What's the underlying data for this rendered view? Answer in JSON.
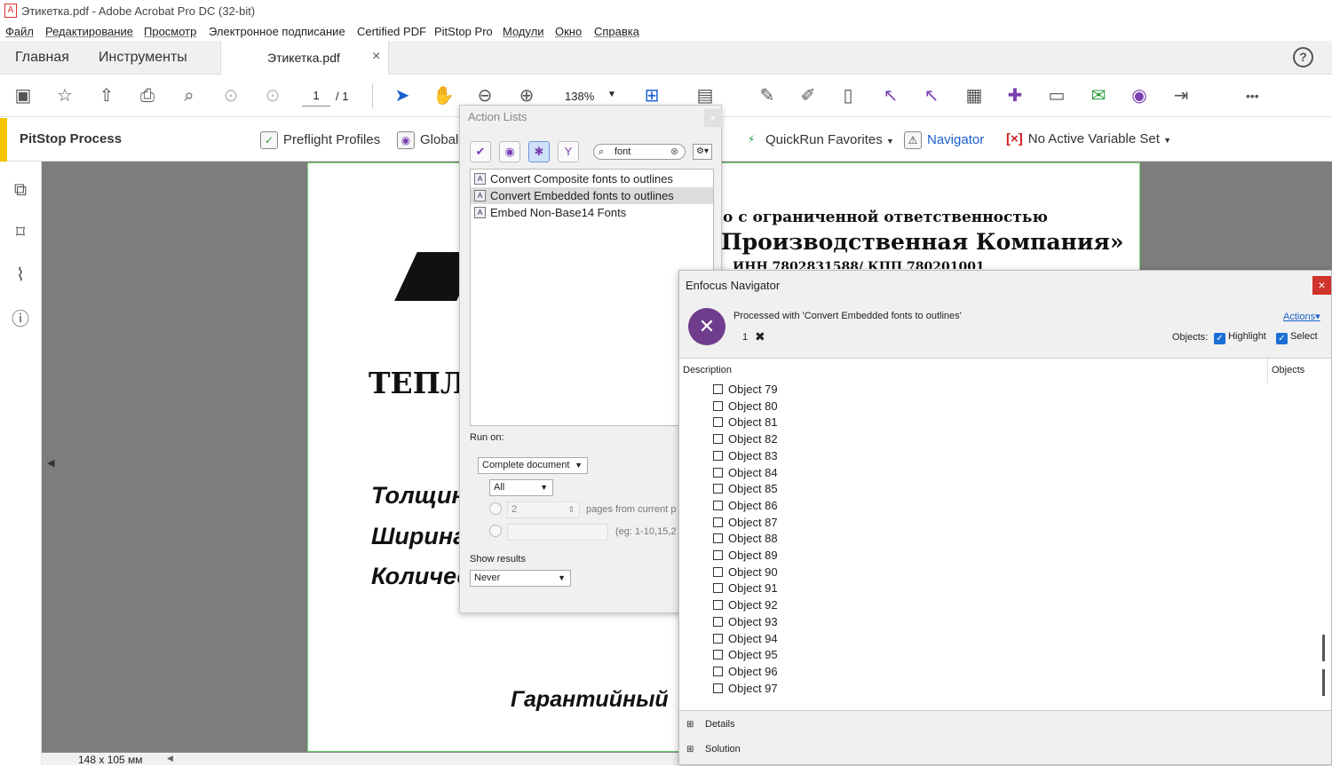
{
  "window": {
    "title": "Этикетка.pdf - Adobe Acrobat Pro DC (32-bit)"
  },
  "menu": [
    "Файл",
    "Редактирование",
    "Просмотр",
    "Электронное подписание",
    "Certified PDF",
    "PitStop Pro",
    "Модули",
    "Окно",
    "Справка"
  ],
  "tabs": {
    "home": "Главная",
    "tools": "Инструменты",
    "doc": "Этикетка.pdf",
    "close": "×",
    "help": "?"
  },
  "toolbar": {
    "page_current": "1",
    "page_total": "/ 1",
    "zoom": "138%",
    "more": "•••"
  },
  "pitstop": {
    "label": "PitStop Process",
    "preflight": "Preflight Profiles",
    "global": "Global",
    "quickrun": "QuickRun Favorites",
    "navigator": "Navigator",
    "variable": "No Active Variable Set"
  },
  "document": {
    "line1": "о с ограниченной ответственностью",
    "line2": "Производственная Компания»",
    "line3": "ИНН 7802831588/ КПП 780201001",
    "big": "ТЕПЛ",
    "l1": "Толщин",
    "l2": "Ширина",
    "l3": "Количес",
    "bottom": "Гарантийный",
    "size": "148 x 105 мм"
  },
  "action_lists": {
    "title": "Action Lists",
    "search": "font",
    "items": [
      "Convert Composite fonts to outlines",
      "Convert Embedded fonts to outlines",
      "Embed Non-Base14 Fonts"
    ],
    "run_on_label": "Run on:",
    "run_on_value": "Complete document",
    "pages_value": "All",
    "pages_num": "2",
    "pages_from": "pages from current p",
    "eg": "(eg: 1-10,15,2",
    "show_results_label": "Show results",
    "show_results_value": "Never"
  },
  "navigator": {
    "title": "Enfocus Navigator",
    "close": "×",
    "processed": "Processed with 'Convert Embedded fonts to outlines'",
    "count": "1",
    "actions": "Actions",
    "objects_label": "Objects:",
    "highlight": "Highlight",
    "select": "Select",
    "col_description": "Description",
    "col_objects": "Objects",
    "objects": [
      "Object 79",
      "Object 80",
      "Object 81",
      "Object 82",
      "Object 83",
      "Object 84",
      "Object 85",
      "Object 86",
      "Object 87",
      "Object 88",
      "Object 89",
      "Object 90",
      "Object 91",
      "Object 92",
      "Object 93",
      "Object 94",
      "Object 95",
      "Object 96",
      "Object 97"
    ],
    "details": "Details",
    "solution": "Solution"
  }
}
